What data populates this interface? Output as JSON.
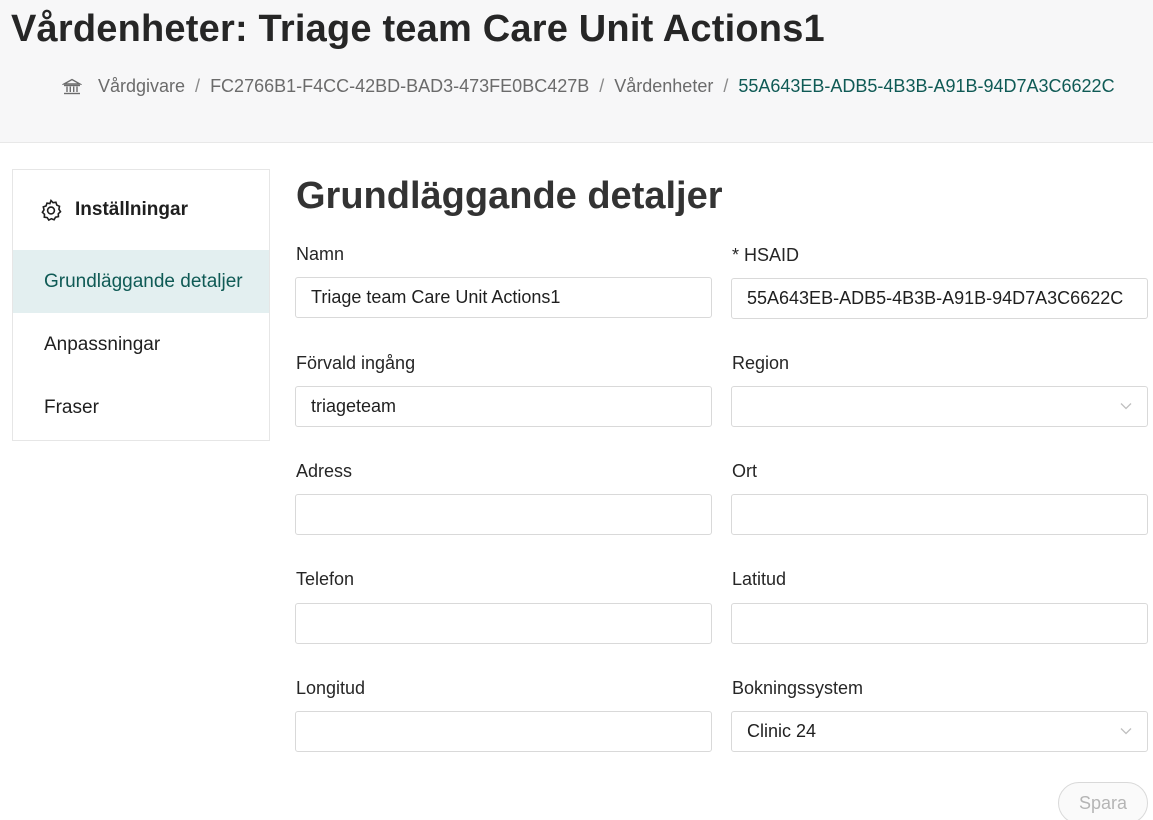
{
  "header": {
    "title": "Vårdenheter: Triage team Care Unit Actions1",
    "breadcrumb": {
      "home_icon": "bank-icon",
      "items": [
        "Vårdgivare",
        "FC2766B1-F4CC-42BD-BAD3-473FE0BC427B",
        "Vårdenheter",
        "55A643EB-ADB5-4B3B-A91B-94D7A3C6622C"
      ],
      "separator": "/"
    }
  },
  "sidebar": {
    "heading": "Inställningar",
    "heading_icon": "gear-icon",
    "items": [
      {
        "label": "Grundläggande detaljer",
        "active": true
      },
      {
        "label": "Anpassningar",
        "active": false
      },
      {
        "label": "Fraser",
        "active": false
      }
    ]
  },
  "main": {
    "title": "Grundläggande detaljer",
    "fields": {
      "namn": {
        "label": "Namn",
        "value": "Triage team Care Unit Actions1"
      },
      "hsaid": {
        "label": "* HSAID",
        "value": "55A643EB-ADB5-4B3B-A91B-94D7A3C6622C"
      },
      "forvald_ingang": {
        "label": "Förvald ingång",
        "value": "triageteam"
      },
      "region": {
        "label": "Region",
        "value": ""
      },
      "adress": {
        "label": "Adress",
        "value": ""
      },
      "ort": {
        "label": "Ort",
        "value": ""
      },
      "telefon": {
        "label": "Telefon",
        "value": ""
      },
      "latitud": {
        "label": "Latitud",
        "value": ""
      },
      "longitud": {
        "label": "Longitud",
        "value": ""
      },
      "bokningssystem": {
        "label": "Bokningssystem",
        "value": "Clinic 24"
      }
    },
    "save_label": "Spara"
  },
  "colors": {
    "accent": "#0f5a55",
    "active_bg": "#e3eff0",
    "header_bg": "#f7f7f8"
  }
}
